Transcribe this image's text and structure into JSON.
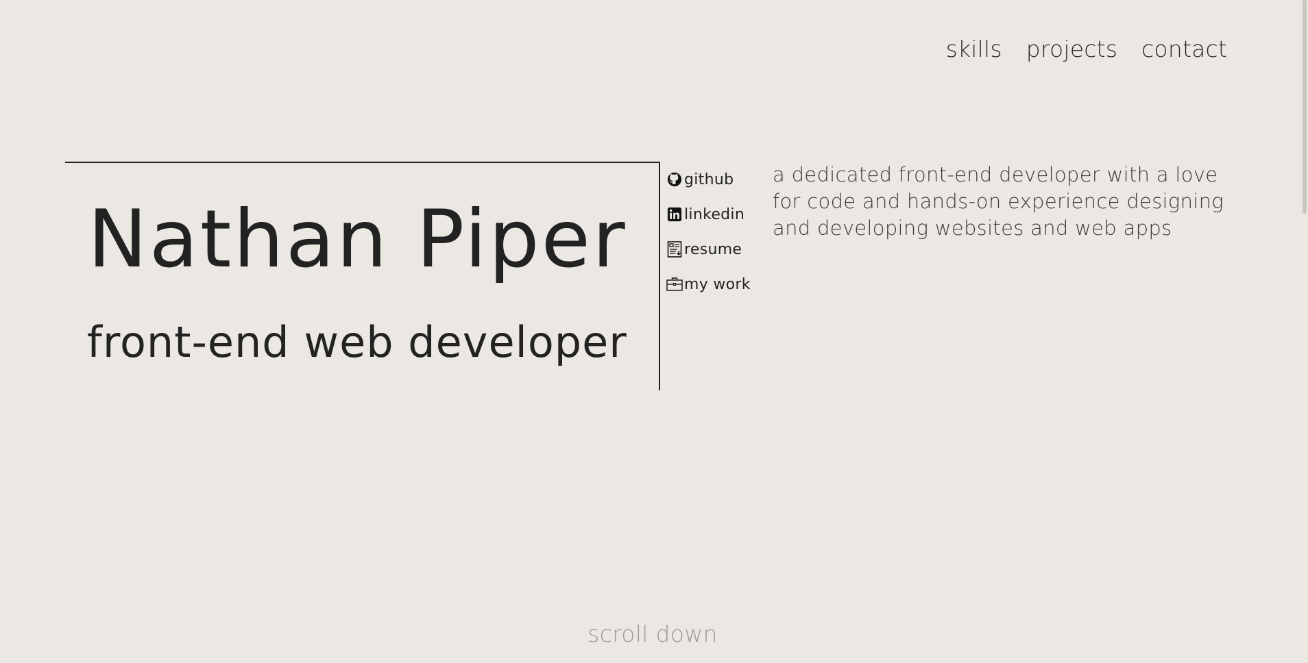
{
  "nav": {
    "items": [
      {
        "label": "skills"
      },
      {
        "label": "projects"
      },
      {
        "label": "contact"
      }
    ]
  },
  "hero": {
    "name": "Nathan Piper",
    "role": "front-end web developer"
  },
  "links": [
    {
      "label": "github",
      "icon": "github-icon"
    },
    {
      "label": "linkedin",
      "icon": "linkedin-icon"
    },
    {
      "label": "resume",
      "icon": "resume-icon"
    },
    {
      "label": "my work",
      "icon": "briefcase-icon"
    }
  ],
  "intro": {
    "text": "a dedicated front-end developer with a love for code and hands-on experience designing and developing websites and web apps"
  },
  "footer": {
    "scroll_hint": "scroll down"
  },
  "colors": {
    "background": "#ebe8e3",
    "text": "#222222",
    "muted": "#9a9a9a"
  }
}
